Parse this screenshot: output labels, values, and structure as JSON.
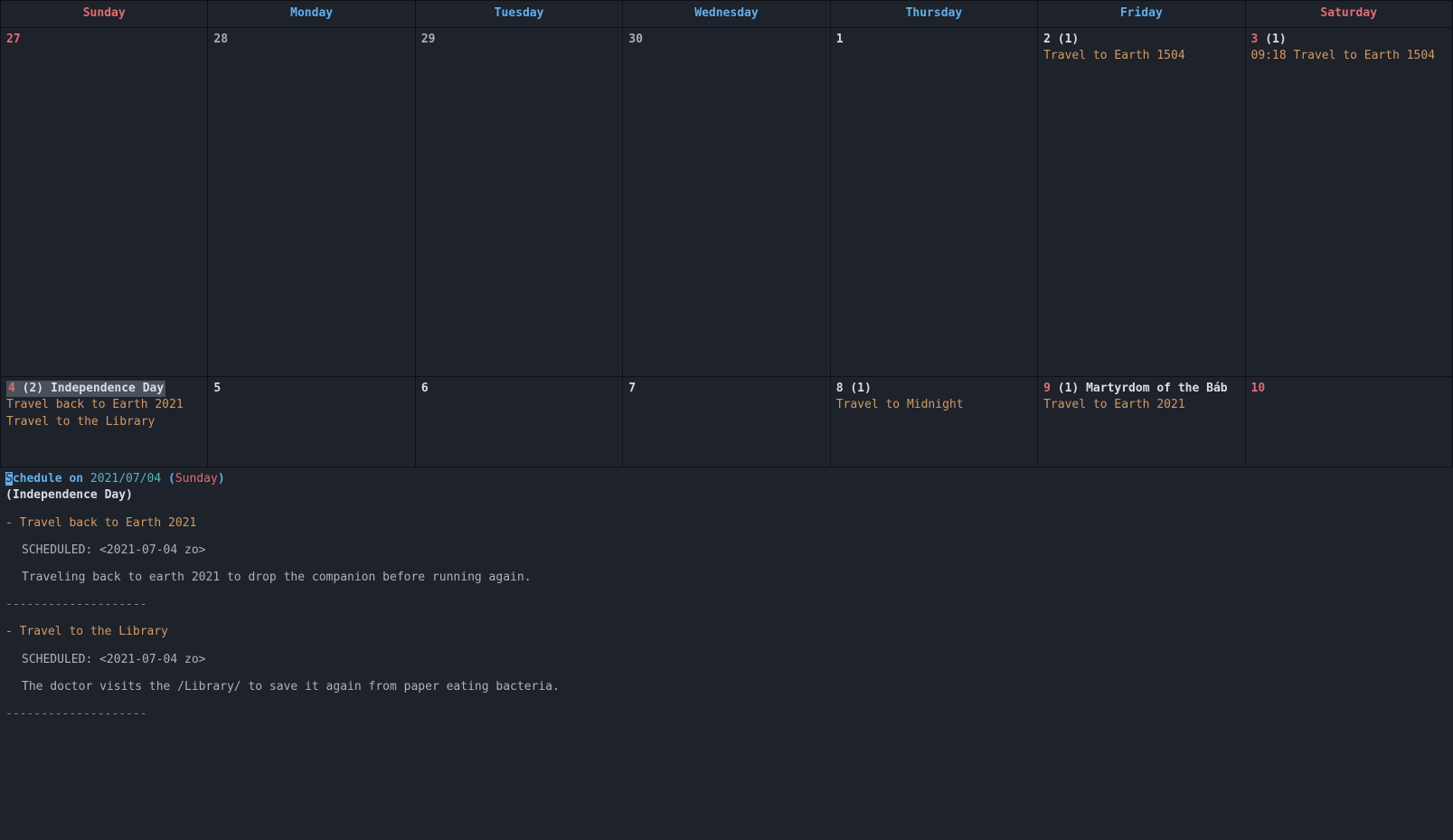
{
  "headers": [
    "Sunday",
    "Monday",
    "Tuesday",
    "Wednesday",
    "Thursday",
    "Friday",
    "Saturday"
  ],
  "week1": {
    "sun": {
      "num": "27"
    },
    "mon": {
      "num": "28"
    },
    "tue": {
      "num": "29"
    },
    "wed": {
      "num": "30"
    },
    "thu": {
      "num": "1"
    },
    "fri": {
      "num": "2",
      "count": "(1)",
      "events": [
        "Travel to Earth 1504"
      ]
    },
    "sat": {
      "num": "3",
      "count": "(1)",
      "events": [
        "09:18 Travel to Earth 1504"
      ]
    }
  },
  "week2": {
    "sun": {
      "num": "4",
      "count": "(2)",
      "holiday": "Independence Day",
      "events": [
        "Travel back to Earth 2021",
        "Travel to the Library"
      ]
    },
    "mon": {
      "num": "5"
    },
    "tue": {
      "num": "6"
    },
    "wed": {
      "num": "7"
    },
    "thu": {
      "num": "8",
      "count": "(1)",
      "events": [
        "Travel to Midnight"
      ]
    },
    "fri": {
      "num": "9",
      "count": "(1)",
      "holiday": "Martyrdom of the Báb",
      "events": [
        "Travel to Earth 2021"
      ]
    },
    "sat": {
      "num": "10"
    }
  },
  "schedule": {
    "title_prefix_char": "S",
    "title_rest": "chedule on ",
    "date": "2021/07/04",
    "paren_open": " (",
    "dayname": "Sunday",
    "paren_close": ")",
    "subtitle": "(Independence Day)",
    "items": [
      {
        "title": "-  Travel back to Earth 2021",
        "scheduled": "SCHEDULED: <2021-07-04 zo>",
        "desc": "Traveling back to earth 2021 to drop the companion before running again."
      },
      {
        "title": "-  Travel to the Library",
        "scheduled": "SCHEDULED: <2021-07-04 zo>",
        "desc": " The doctor visits the /Library/ to save it again from paper eating bacteria."
      }
    ],
    "separator": "--------------------"
  }
}
